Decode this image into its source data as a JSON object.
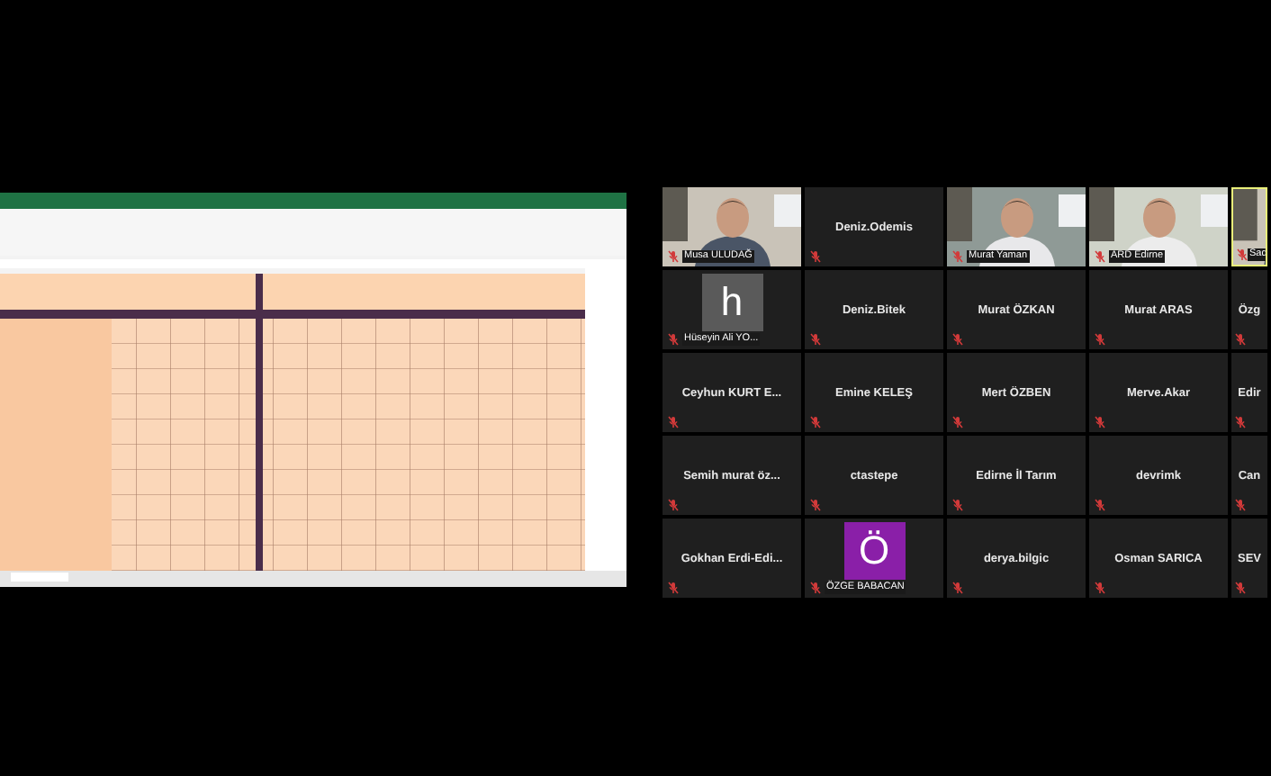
{
  "participants": [
    {
      "name": "Musa ULUDAĞ",
      "kind": "video",
      "speaking": false
    },
    {
      "name": "Deniz.Odemis",
      "kind": "name",
      "speaking": false
    },
    {
      "name": "Murat Yaman",
      "kind": "video",
      "speaking": false
    },
    {
      "name": "ARD Edirne",
      "kind": "video",
      "speaking": false
    },
    {
      "name": "Sad",
      "kind": "video",
      "speaking": true
    },
    {
      "name": "Hüseyin Ali YO...",
      "kind": "avatar",
      "avatar": "h",
      "color": "#5a5a5a",
      "speaking": false
    },
    {
      "name": "Deniz.Bitek",
      "kind": "name",
      "speaking": false
    },
    {
      "name": "Murat ÖZKAN",
      "kind": "name",
      "speaking": false
    },
    {
      "name": "Murat ARAS",
      "kind": "name",
      "speaking": false
    },
    {
      "name": "Özg",
      "kind": "name",
      "speaking": false
    },
    {
      "name": "Ceyhun KURT E...",
      "kind": "name",
      "speaking": false
    },
    {
      "name": "Emine KELEŞ",
      "kind": "name",
      "speaking": false
    },
    {
      "name": "Mert ÖZBEN",
      "kind": "name",
      "speaking": false
    },
    {
      "name": "Merve.Akar",
      "kind": "name",
      "speaking": false
    },
    {
      "name": "Edir",
      "kind": "name",
      "speaking": false
    },
    {
      "name": "Semih murat öz...",
      "kind": "name",
      "speaking": false
    },
    {
      "name": "ctastepe",
      "kind": "name",
      "speaking": false
    },
    {
      "name": "Edirne İl Tarım",
      "kind": "name",
      "speaking": false
    },
    {
      "name": "devrimk",
      "kind": "name",
      "speaking": false
    },
    {
      "name": "Can",
      "kind": "name",
      "speaking": false
    },
    {
      "name": "Gokhan  Erdi-Edi...",
      "kind": "name",
      "speaking": false
    },
    {
      "name": "ÖZGE BABACAN",
      "kind": "avatar",
      "avatar": "Ö",
      "color": "#8a1fa8",
      "speaking": false
    },
    {
      "name": "derya.bilgic",
      "kind": "name",
      "speaking": false
    },
    {
      "name": "Osman SARICA",
      "kind": "name",
      "speaking": false
    },
    {
      "name": "SEV",
      "kind": "name",
      "speaking": false
    }
  ]
}
